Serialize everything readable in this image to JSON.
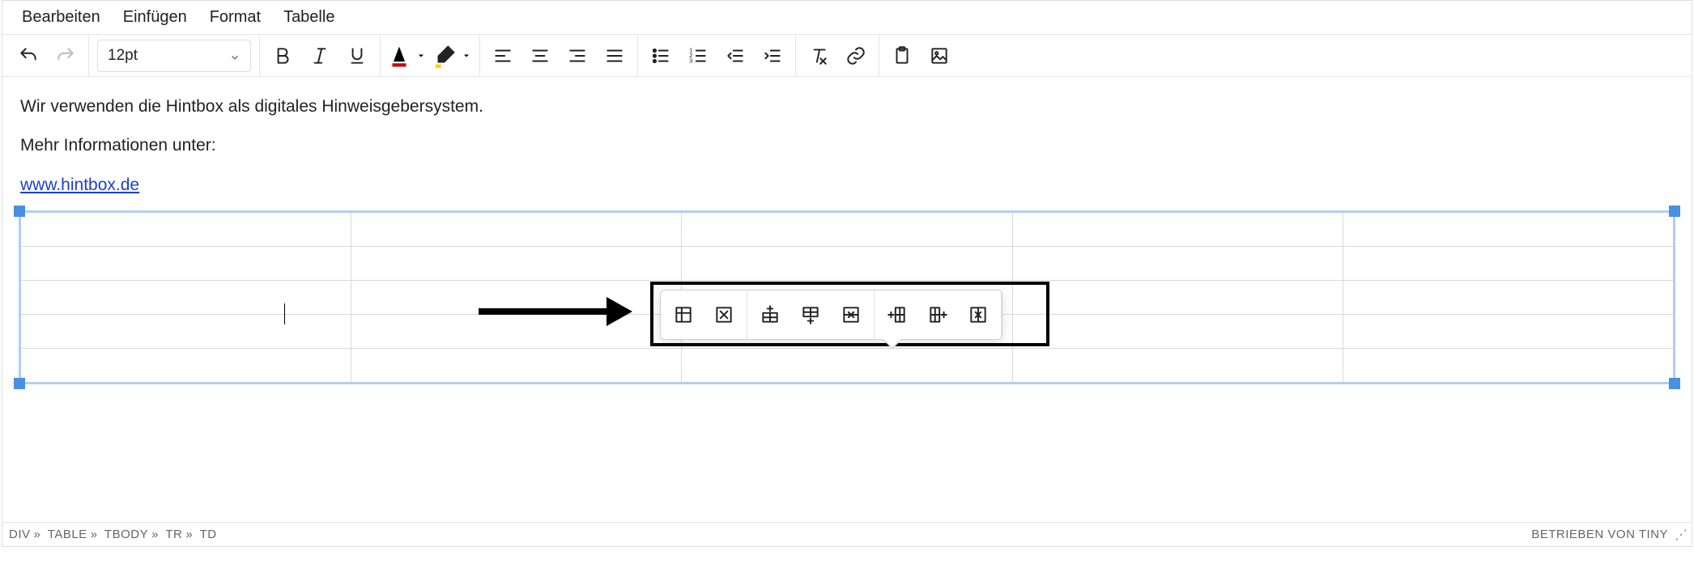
{
  "menubar": [
    "Bearbeiten",
    "Einfügen",
    "Format",
    "Tabelle"
  ],
  "font_size": "12pt",
  "content": {
    "p1": "Wir verwenden die Hintbox als digitales Hinweisgebersystem.",
    "p2": "Mehr Informationen unter:",
    "link_text": "www.hintbox.de"
  },
  "table": {
    "rows": 5,
    "cols": 5
  },
  "path": [
    "DIV",
    "TABLE",
    "TBODY",
    "TR",
    "TD"
  ],
  "path_sep": "»",
  "powered_by": "BETRIEBEN VON TINY",
  "popup_tools": {
    "group1": [
      "table-properties",
      "table-delete"
    ],
    "group2": [
      "row-insert-before",
      "row-insert-after",
      "row-delete"
    ],
    "group3": [
      "col-insert-before",
      "col-insert-after",
      "col-delete"
    ]
  }
}
